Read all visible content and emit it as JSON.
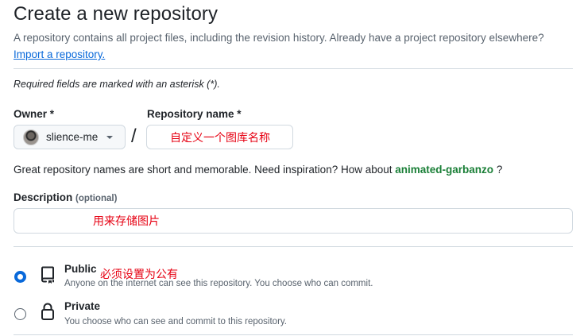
{
  "page": {
    "title": "Create a new repository",
    "subtitle": "A repository contains all project files, including the revision history. Already have a project repository elsewhere?",
    "import_link": "Import a repository."
  },
  "required_note": "Required fields are marked with an asterisk (*).",
  "owner": {
    "label": "Owner *",
    "value": "slience-me"
  },
  "separator": "/",
  "repository_name": {
    "label": "Repository name *",
    "value": "自定义一个图库名称"
  },
  "hint": {
    "text": "Great repository names are short and memorable. Need inspiration? How about",
    "suggestion": "animated-garbanzo",
    "suffix": "?"
  },
  "description": {
    "label": "Description",
    "optional": "(optional)",
    "value": "用来存储图片"
  },
  "visibility": {
    "annotation": "必须设置为公有",
    "options": [
      {
        "label": "Public",
        "description": "Anyone on the internet can see this repository. You choose who can commit.",
        "selected": true,
        "icon": "repo-icon"
      },
      {
        "label": "Private",
        "description": "You choose who can see and commit to this repository.",
        "selected": false,
        "icon": "lock-icon"
      }
    ]
  },
  "colors": {
    "link": "#0969da",
    "suggestion": "#1a7f37",
    "annotation": "#e60012",
    "radio_selected": "#0969da"
  }
}
